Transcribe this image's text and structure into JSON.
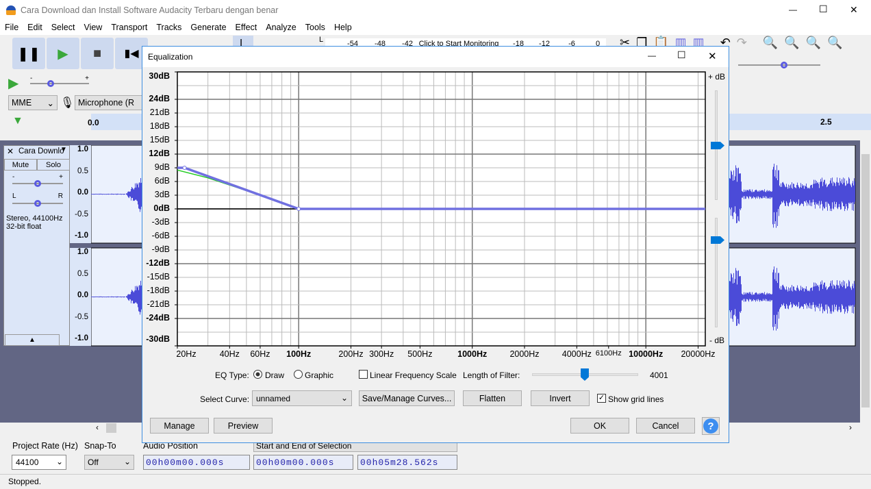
{
  "window": {
    "title": "Cara Download dan Install Software Audacity Terbaru dengan benar",
    "minimize": "—",
    "maximize": "☐",
    "close": "✕"
  },
  "menu": [
    "File",
    "Edit",
    "Select",
    "View",
    "Transport",
    "Tracks",
    "Generate",
    "Effect",
    "Analyze",
    "Tools",
    "Help"
  ],
  "toolbar": {
    "meter_channel": "L",
    "meter_ticks": [
      "-54",
      "-48",
      "-42",
      "Click to Start Monitoring",
      "-18",
      "-12",
      "-6",
      "0"
    ],
    "host": "MME",
    "input_device": "Microphone (R",
    "timeline_start": "0.0",
    "timeline_mark": "2.5"
  },
  "track": {
    "name": "Cara Downlo",
    "mute": "Mute",
    "solo": "Solo",
    "gain_minus": "-",
    "gain_plus": "+",
    "pan_left": "L",
    "pan_right": "R",
    "info1": "Stereo, 44100Hz",
    "info2": "32-bit float",
    "scale": [
      "1.0",
      "0.5",
      "0.0",
      "-0.5",
      "-1.0"
    ]
  },
  "dialog": {
    "title": "Equalization",
    "plus_db": "+ dB",
    "minus_db": "- dB",
    "eq_type_label": "EQ Type:",
    "draw": "Draw",
    "graphic": "Graphic",
    "eq_type_selected": "Draw",
    "linear_label": "Linear Frequency Scale",
    "linear_checked": false,
    "filter_length_label": "Length of Filter:",
    "filter_length": "4001",
    "filter_length_fraction": 0.49,
    "select_curve_label": "Select Curve:",
    "curve": "unnamed",
    "save_manage": "Save/Manage Curves...",
    "flatten": "Flatten",
    "invert": "Invert",
    "grid_label": "Show grid lines",
    "grid_checked": true,
    "manage": "Manage",
    "preview": "Preview",
    "ok": "OK",
    "cancel": "Cancel",
    "help": "?"
  },
  "chart_data": {
    "type": "line",
    "y_ticks": [
      "30dB",
      "24dB",
      "21dB",
      "18dB",
      "15dB",
      "12dB",
      "9dB",
      "6dB",
      "3dB",
      "0dB",
      "-3dB",
      "-6dB",
      "-9dB",
      "-12dB",
      "-15dB",
      "-18dB",
      "-21dB",
      "-24dB",
      "-30dB"
    ],
    "y_tick_values": [
      30,
      24,
      21,
      18,
      15,
      12,
      9,
      6,
      3,
      0,
      -3,
      -6,
      -9,
      -12,
      -15,
      -18,
      -21,
      -24,
      -30
    ],
    "bold_y": [
      "30dB",
      "24dB",
      "12dB",
      "0dB",
      "-12dB",
      "-24dB",
      "-30dB"
    ],
    "x_ticks": [
      "20Hz",
      "40Hz",
      "60Hz",
      "100Hz",
      "200Hz",
      "300Hz",
      "500Hz",
      "1000Hz",
      "2000Hz",
      "4000Hz",
      "6100Hz",
      "10000Hz",
      "20000Hz"
    ],
    "x_tick_values": [
      20,
      40,
      60,
      100,
      200,
      300,
      500,
      1000,
      2000,
      4000,
      6100,
      10000,
      20000
    ],
    "bold_x": [
      "100Hz",
      "1000Hz",
      "10000Hz"
    ],
    "xscale": "log",
    "xlim": [
      20,
      22000
    ],
    "ylim": [
      -30,
      30
    ],
    "grid": true,
    "curve_points": [
      [
        20,
        9
      ],
      [
        22,
        9
      ],
      [
        100,
        0
      ],
      [
        22000,
        0
      ]
    ],
    "response_points": [
      [
        20,
        8.5
      ],
      [
        30,
        6.8
      ],
      [
        50,
        4.0
      ],
      [
        100,
        0
      ],
      [
        22000,
        0
      ]
    ],
    "colors": {
      "curve": "#7070e0",
      "response": "#22cc22",
      "zero": "#000000"
    }
  },
  "selection_toolbar": {
    "rate_label": "Project Rate (Hz)",
    "rate": "44100",
    "snap_label": "Snap-To",
    "snap": "Off",
    "pos_label": "Audio Position",
    "sel_label": "Start and End of Selection",
    "pos": "00h00m00.000s",
    "sel_start": "00h00m00.000s",
    "sel_end": "00h05m28.562s"
  },
  "status": "Stopped."
}
